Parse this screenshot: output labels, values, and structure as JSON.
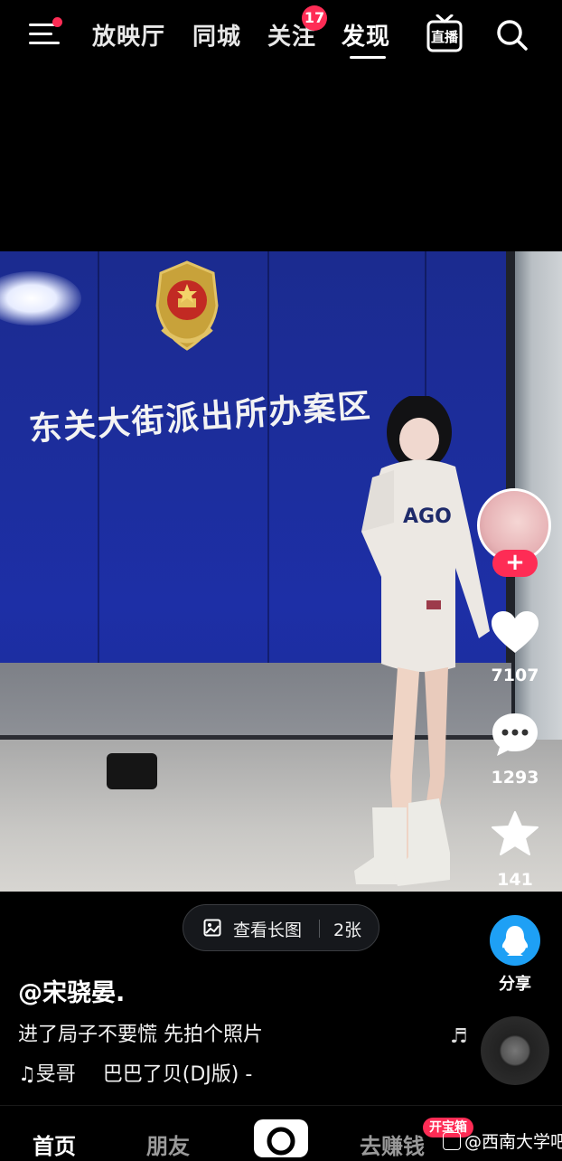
{
  "top_nav": {
    "tabs": [
      {
        "label": "放映厅"
      },
      {
        "label": "同城"
      },
      {
        "label": "关注",
        "badge": "17"
      },
      {
        "label": "发现",
        "active": true
      }
    ],
    "live_label": "直播",
    "icons": {
      "menu": "menu-icon",
      "search": "search-icon"
    }
  },
  "photo": {
    "sign_text": "东关大街派出所办案区",
    "shirt_text": "AGO"
  },
  "actions": {
    "likes": "7107",
    "comments": "1293",
    "favorites": "141",
    "follow_symbol": "+",
    "share_label": "分享"
  },
  "view_long_image": {
    "label": "查看长图",
    "count": "2张"
  },
  "post": {
    "author": "@宋骁晏.",
    "caption": "进了局子不要慌 先拍个照片",
    "music_artist": "旻哥",
    "music_title": "巴巴了贝(DJ版) -"
  },
  "bottom_nav": {
    "items": [
      "首页",
      "朋友",
      "去赚钱"
    ],
    "treasure_badge": "开宝箱",
    "watermark": "@西南大学吧"
  },
  "colors": {
    "accent": "#fe2c55",
    "share": "#1ea0f5",
    "wall": "#1d2fa6"
  }
}
